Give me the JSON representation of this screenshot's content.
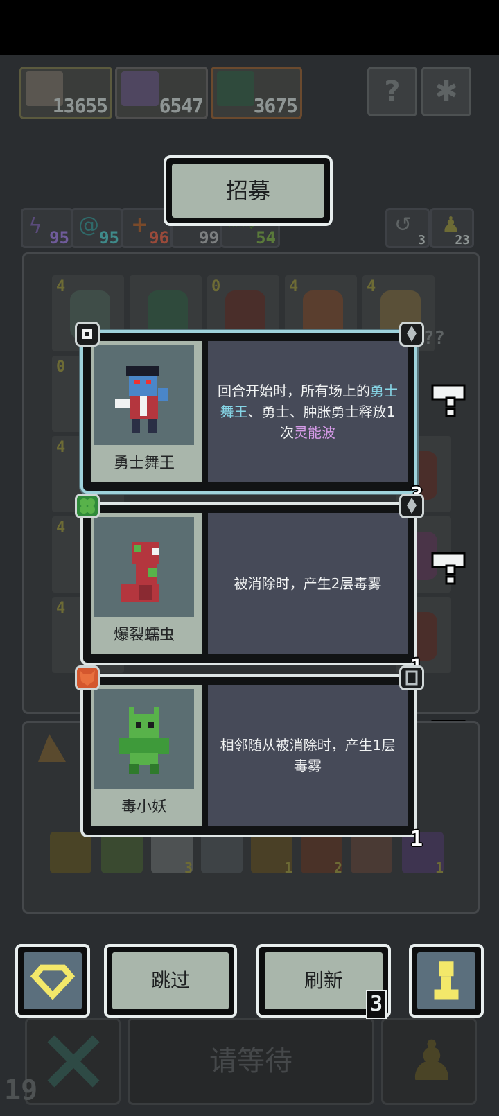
{
  "resources": [
    {
      "name": "hero-portrait",
      "value": "13655"
    },
    {
      "name": "staff",
      "value": "6547"
    },
    {
      "name": "dino",
      "value": "3675"
    }
  ],
  "top_buttons": [
    "help-icon",
    "settings-icon"
  ],
  "stats": [
    {
      "icon": "lightning-icon",
      "value": "95",
      "color": "#6f5b9a"
    },
    {
      "icon": "swirl-icon",
      "value": "95",
      "color": "#3f8a8a"
    },
    {
      "icon": "plus-icon",
      "value": "96",
      "color": "#9a4a3a"
    },
    {
      "icon": "sword-icon",
      "value": "99",
      "color": "#7c7f80"
    },
    {
      "icon": "bow-icon",
      "value": "54",
      "color": "#5a7a3a"
    }
  ],
  "side_counters": [
    {
      "icon": "recycle-icon",
      "value": "3"
    },
    {
      "icon": "pawn-icon",
      "value": "23"
    }
  ],
  "title": "招募",
  "cards": [
    {
      "name": "勇士舞王",
      "desc_parts": [
        {
          "t": "回合开始时，所有场上的",
          "c": ""
        },
        {
          "t": "勇士舞王",
          "c": "hl-blue"
        },
        {
          "t": "、勇士、肿胀勇士释放1次",
          "c": ""
        },
        {
          "t": "灵能波",
          "c": "hl-purple"
        }
      ],
      "count": "3",
      "left_badge": "gem-badge-icon",
      "right_badge": "sword-badge-icon"
    },
    {
      "name": "爆裂蠕虫",
      "desc_parts": [
        {
          "t": "被消除时，产生2层毒雾",
          "c": ""
        }
      ],
      "count": "1",
      "left_badge": "clover-badge-icon",
      "right_badge": "sword-badge-icon"
    },
    {
      "name": "毒小妖",
      "desc_parts": [
        {
          "t": "相邻随从被消除时，产生1层毒雾",
          "c": ""
        }
      ],
      "count": "1",
      "left_badge": "fox-badge-icon",
      "right_badge": "shield-badge-icon"
    }
  ],
  "buttons": {
    "diamond": "diamond-icon",
    "skip": "跳过",
    "refresh": "刷新",
    "refresh_count": "3",
    "pawn": "pawn-icon"
  },
  "wait_label": "请等待",
  "turn": "19",
  "board_levels": [
    "4",
    "",
    "0",
    "4",
    "4",
    "0",
    "",
    "",
    "",
    "",
    "4",
    "",
    "",
    "",
    "",
    "4",
    "",
    "",
    "",
    "",
    "4",
    "",
    "",
    "",
    ""
  ],
  "shop_items": [
    {
      "icon": "staff-icon",
      "count": ""
    },
    {
      "icon": "chest-icon",
      "count": ""
    },
    {
      "icon": "claw-icon",
      "count": "3"
    },
    {
      "icon": "shuriken-icon",
      "count": ""
    },
    {
      "icon": "star-icon",
      "count": "1"
    },
    {
      "icon": "boot-icon",
      "count": "2"
    },
    {
      "icon": "hand-icon",
      "count": ""
    },
    {
      "icon": "orb-icon",
      "count": "1"
    }
  ],
  "hidden_level": "???"
}
